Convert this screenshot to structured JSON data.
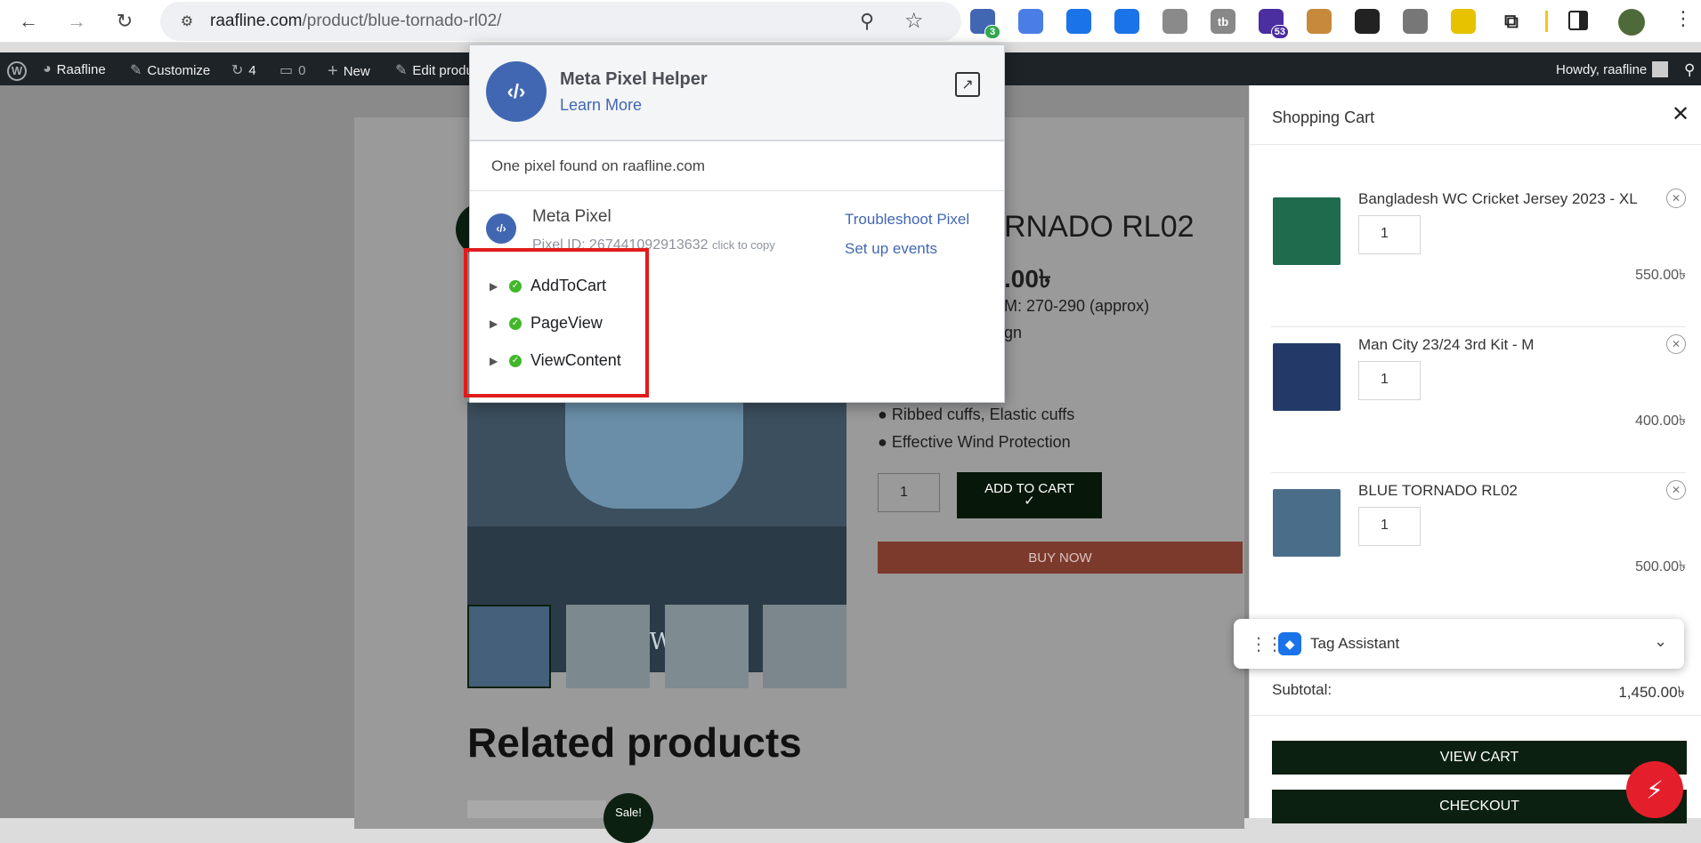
{
  "browser": {
    "url_domain": "raafline.com",
    "url_path": "/product/blue-tornado-rl02/",
    "extensions": [
      {
        "name": "meta-pixel-ext",
        "badge": "3",
        "color": "#4267b2"
      },
      {
        "name": "extension-2",
        "color": "#4a7ee6"
      },
      {
        "name": "extension-3",
        "color": "#1a73e8"
      },
      {
        "name": "extension-4",
        "color": "#1a73e8"
      },
      {
        "name": "extension-5",
        "color": "#8a8a8a"
      },
      {
        "name": "extension-6",
        "label": "tb",
        "color": "#888888"
      },
      {
        "name": "extension-7",
        "badge": "53",
        "color": "#4b2ea0"
      },
      {
        "name": "cookie-ext",
        "color": "#c68a3a"
      },
      {
        "name": "extension-9",
        "color": "#222222"
      },
      {
        "name": "extension-10",
        "color": "#777777"
      },
      {
        "name": "extension-11",
        "color": "#e6c200"
      }
    ]
  },
  "wpbar": {
    "site": "Raafline",
    "customize": "Customize",
    "updates": "4",
    "comments": "0",
    "new": "New",
    "edit": "Edit produ",
    "howdy": "Howdy, raafline"
  },
  "popup": {
    "title": "Meta Pixel Helper",
    "learn_more": "Learn More",
    "found": "One pixel found on raafline.com",
    "pixel_name": "Meta Pixel",
    "pixel_id": "Pixel ID: 267441092913632",
    "click_copy": "click to copy",
    "troubleshoot": "Troubleshoot Pixel",
    "setup": "Set up events",
    "events": [
      "AddToCart",
      "PageView",
      "ViewContent"
    ]
  },
  "product": {
    "title_fragment": "RNADO RL02",
    "price_fragment": ".00৳",
    "size_fragment": "M: 270-290 (approx)",
    "design_fragment": "gn",
    "bullets": [
      "● Ribbed cuffs, Elastic cuffs",
      "● Effective Wind Protection"
    ],
    "qty": "1",
    "add_to_cart": "ADD TO CART ✓",
    "buy_now": "BUY NOW",
    "image_caption": "Dark Winter",
    "related": "Related products",
    "sale": "Sale!"
  },
  "cart": {
    "title": "Shopping Cart",
    "items": [
      {
        "name": "Bangladesh WC Cricket Jersey 2023 - XL",
        "qty": "1",
        "price": "550.00৳"
      },
      {
        "name": "Man City 23/24 3rd Kit - M",
        "qty": "1",
        "price": "400.00৳"
      },
      {
        "name": "BLUE TORNADO RL02",
        "qty": "1",
        "price": "500.00৳"
      }
    ],
    "subtotal_label": "Subtotal:",
    "subtotal_value": "1,450.00৳",
    "view_cart": "VIEW CART",
    "checkout": "CHECKOUT"
  },
  "tag_assistant": {
    "label": "Tag Assistant"
  },
  "colors": {
    "accent_green": "#0b2010",
    "buy_now": "#b8503a",
    "highlight_box": "#e01b1b",
    "meta_blue": "#4267b2"
  }
}
